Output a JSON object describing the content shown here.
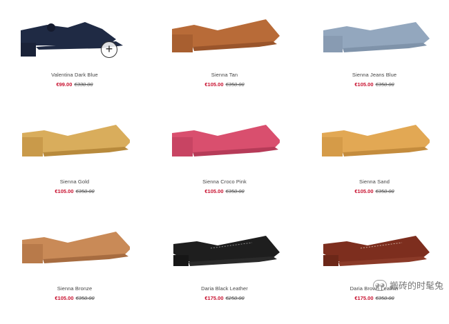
{
  "products": [
    {
      "name": "Valentina Dark Blue",
      "price": "€99.00",
      "old_price": "€330.00",
      "colors": {
        "upper": "#1f2a44",
        "heel": "#1a2238",
        "sole": "#1f2a44"
      }
    },
    {
      "name": "Sienna Tan",
      "price": "€105.00",
      "old_price": "€350.00",
      "colors": {
        "upper": "#b86b38",
        "heel": "#a85f30",
        "sole": "#9a552b"
      }
    },
    {
      "name": "Sienna Jeans Blue",
      "price": "€105.00",
      "old_price": "€350.00",
      "colors": {
        "upper": "#93a7be",
        "heel": "#889bb2",
        "sole": "#7f93aa"
      }
    },
    {
      "name": "Sienna Gold",
      "price": "€105.00",
      "old_price": "€350.00",
      "colors": {
        "upper": "#d9ad5c",
        "heel": "#c99a4a",
        "sole": "#b88a3c"
      }
    },
    {
      "name": "Sienna Croco Pink",
      "price": "€105.00",
      "old_price": "€350.00",
      "colors": {
        "upper": "#d94f6e",
        "heel": "#c84463",
        "sole": "#b63b58"
      }
    },
    {
      "name": "Sienna Sand",
      "price": "€105.00",
      "old_price": "€350.00",
      "colors": {
        "upper": "#e2a854",
        "heel": "#d59b48",
        "sole": "#c48c3d"
      }
    },
    {
      "name": "Sienna Bronze",
      "price": "€105.00",
      "old_price": "€350.00",
      "colors": {
        "upper": "#c98a57",
        "heel": "#b87a4a",
        "sole": "#a76c40"
      }
    },
    {
      "name": "Daria Black Leather",
      "price": "€175.00",
      "old_price": "€250.00",
      "colors": {
        "upper": "#1e1e1e",
        "heel": "#161616",
        "sole": "#2a2a2a"
      }
    },
    {
      "name": "Daria Brown Leather",
      "price": "€175.00",
      "old_price": "€350.00",
      "colors": {
        "upper": "#7d2e1e",
        "heel": "#6c2718",
        "sole": "#8b3a28"
      }
    }
  ],
  "quick_add": "+",
  "watermark": "搬砖的时髦兔"
}
